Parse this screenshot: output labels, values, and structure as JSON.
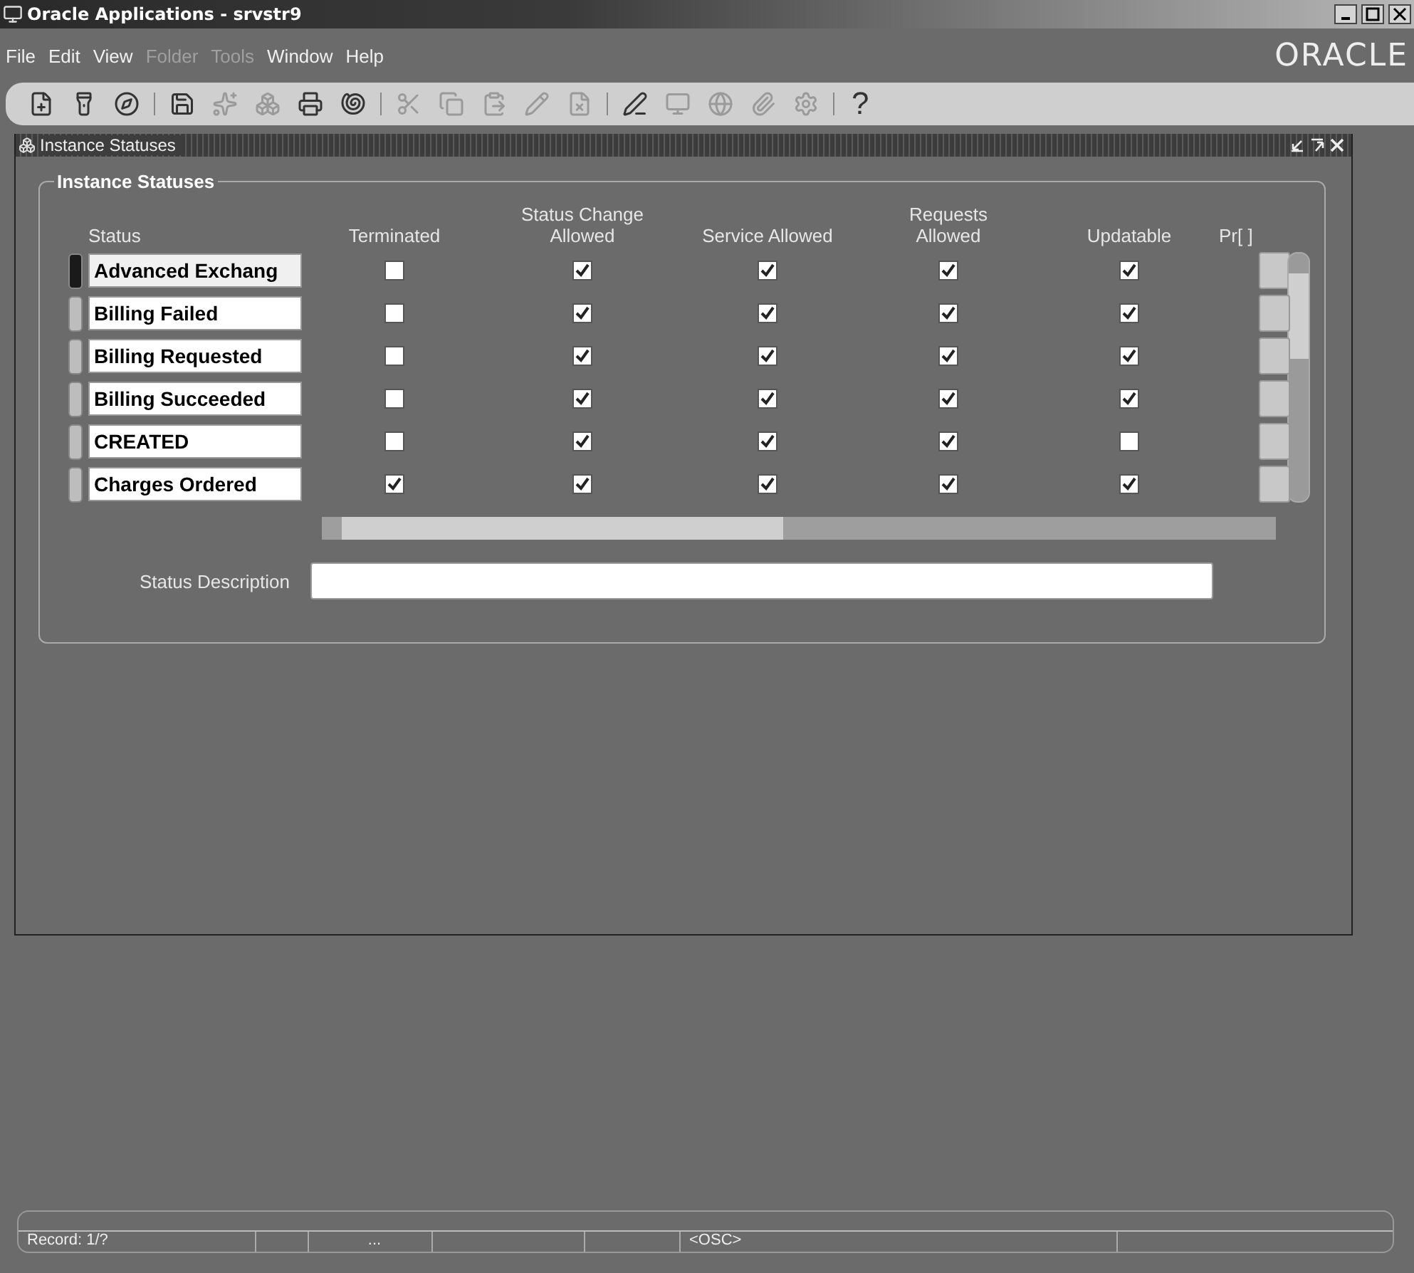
{
  "window": {
    "title": "Oracle Applications - srvstr9"
  },
  "menu": [
    {
      "label": "File",
      "disabled": false
    },
    {
      "label": "Edit",
      "disabled": false
    },
    {
      "label": "View",
      "disabled": false
    },
    {
      "label": "Folder",
      "disabled": true
    },
    {
      "label": "Tools",
      "disabled": true
    },
    {
      "label": "Window",
      "disabled": false
    },
    {
      "label": "Help",
      "disabled": false
    }
  ],
  "brand": "ORACLE",
  "toolbar": [
    {
      "kind": "button",
      "disabled": false
    },
    {
      "kind": "button",
      "disabled": false
    },
    {
      "kind": "button",
      "disabled": false
    },
    {
      "kind": "separator"
    },
    {
      "kind": "button",
      "disabled": false
    },
    {
      "kind": "button",
      "disabled": true
    },
    {
      "kind": "button",
      "disabled": true
    },
    {
      "kind": "button",
      "disabled": false
    },
    {
      "kind": "button",
      "disabled": false
    },
    {
      "kind": "separator"
    },
    {
      "kind": "button",
      "disabled": true
    },
    {
      "kind": "button",
      "disabled": true
    },
    {
      "kind": "button",
      "disabled": true
    },
    {
      "kind": "button",
      "disabled": true
    },
    {
      "kind": "button",
      "disabled": true
    },
    {
      "kind": "separator"
    },
    {
      "kind": "button",
      "disabled": false
    },
    {
      "kind": "button",
      "disabled": true
    },
    {
      "kind": "button",
      "disabled": true
    },
    {
      "kind": "button",
      "disabled": true
    },
    {
      "kind": "button",
      "disabled": true
    },
    {
      "kind": "separator"
    },
    {
      "kind": "help",
      "label": "?"
    }
  ],
  "form": {
    "title": "Instance Statuses",
    "section": "Instance Statuses",
    "columns": [
      "Status",
      "Terminated",
      "Status Change Allowed",
      "Service Allowed",
      "Requests Allowed",
      "Updatable",
      "Pr[ ]"
    ],
    "rows": [
      {
        "status": "Advanced Exchang",
        "selected": true,
        "checks": [
          false,
          true,
          true,
          true,
          true
        ]
      },
      {
        "status": "Billing Failed",
        "selected": false,
        "checks": [
          false,
          true,
          true,
          true,
          true
        ]
      },
      {
        "status": "Billing Requested",
        "selected": false,
        "checks": [
          false,
          true,
          true,
          true,
          true
        ]
      },
      {
        "status": "Billing Succeeded",
        "selected": false,
        "checks": [
          false,
          true,
          true,
          true,
          true
        ]
      },
      {
        "status": "CREATED",
        "selected": false,
        "checks": [
          false,
          true,
          true,
          true,
          false
        ]
      },
      {
        "status": "Charges Ordered",
        "selected": false,
        "checks": [
          true,
          true,
          true,
          true,
          true
        ]
      }
    ],
    "description_label": "Status Description"
  },
  "status_bar": {
    "record": "Record: 1/?",
    "segment_3": "...",
    "mode": "<OSC>"
  }
}
